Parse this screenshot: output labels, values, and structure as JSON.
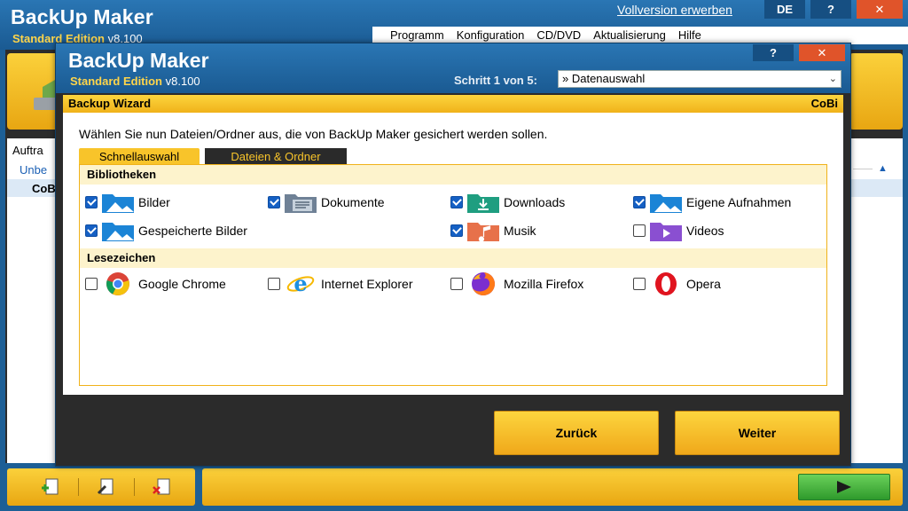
{
  "background": {
    "app_title": "BackUp Maker",
    "edition": "Standard Edition",
    "version": "v8.100",
    "buy_link": "Vollversion erwerben",
    "lang_button": "DE",
    "help_button": "?",
    "close_button": "✕",
    "menu": [
      "Programm",
      "Konfiguration",
      "CD/DVD",
      "Aktualisierung",
      "Hilfe"
    ],
    "list_header": "Auftra",
    "list_row_unsorted": "Unbe",
    "list_row_job": "CoB"
  },
  "dialog": {
    "title": "BackUp Maker",
    "edition": "Standard Edition",
    "version": "v8.100",
    "help_button": "?",
    "close_button": "✕",
    "step_label": "Schritt 1 von 5:",
    "step_value": "» Datenauswahl",
    "wizard_title": "Backup Wizard",
    "wizard_user": "CoBi",
    "instruction": "Wählen Sie nun Dateien/Ordner aus, die von BackUp Maker gesichert werden sollen.",
    "tabs": {
      "quick": "Schnellauswahl",
      "files": "Dateien & Ordner"
    },
    "libraries_title": "Bibliotheken",
    "libraries": [
      {
        "label": "Bilder",
        "checked": true,
        "icon": "pictures-folder-icon"
      },
      {
        "label": "Dokumente",
        "checked": true,
        "icon": "documents-folder-icon"
      },
      {
        "label": "Downloads",
        "checked": true,
        "icon": "downloads-folder-icon"
      },
      {
        "label": "Eigene Aufnahmen",
        "checked": true,
        "icon": "camera-roll-folder-icon"
      },
      {
        "label": "Gespeicherte Bilder",
        "checked": true,
        "icon": "saved-pictures-folder-icon"
      },
      {
        "label": "Musik",
        "checked": true,
        "icon": "music-folder-icon"
      },
      {
        "label": "Videos",
        "checked": false,
        "icon": "videos-folder-icon"
      }
    ],
    "bookmarks_title": "Lesezeichen",
    "bookmarks": [
      {
        "label": "Google Chrome",
        "checked": false,
        "icon": "chrome-icon"
      },
      {
        "label": "Internet Explorer",
        "checked": false,
        "icon": "internet-explorer-icon"
      },
      {
        "label": "Mozilla Firefox",
        "checked": false,
        "icon": "firefox-icon"
      },
      {
        "label": "Opera",
        "checked": false,
        "icon": "opera-icon"
      }
    ],
    "back_button": "Zurück",
    "next_button": "Weiter"
  },
  "colors": {
    "title_blue": "#1a5a92",
    "accent_yellow": "#f8c42a",
    "checkbox_blue": "#1560c4",
    "run_green": "#2f9a2c"
  }
}
